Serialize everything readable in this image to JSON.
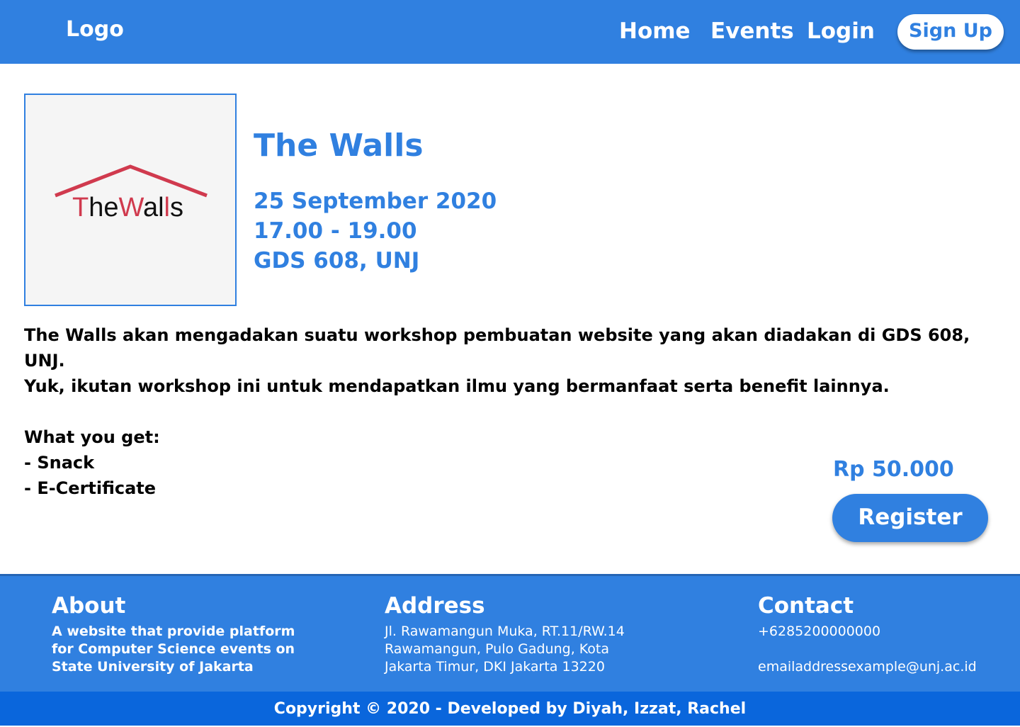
{
  "navbar": {
    "logo": "Logo",
    "links": [
      "Home",
      "Events",
      "Login"
    ],
    "signup_label": "Sign Up"
  },
  "event": {
    "logo_text": {
      "t": "T",
      "he": "he",
      "w": "W",
      "al": "al",
      "l": "l",
      "s": "s"
    },
    "title": "The Walls",
    "date": "25 September 2020",
    "time": "17.00 - 19.00",
    "location": "GDS 608, UNJ",
    "description_lines": [
      "The Walls akan mengadakan suatu workshop pembuatan website yang akan diadakan di GDS 608, UNJ.",
      "Yuk, ikutan workshop ini untuk mendapatkan ilmu yang bermanfaat serta benefit lainnya."
    ],
    "benefits_heading": "What you get:",
    "benefits": [
      "- Snack",
      "- E-Certificate"
    ],
    "price": "Rp 50.000",
    "register_label": "Register"
  },
  "footer": {
    "about": {
      "heading": "About",
      "lines": [
        "A website that provide platform",
        "for Computer Science events on",
        "State University of Jakarta"
      ]
    },
    "address": {
      "heading": "Address",
      "lines": [
        "Jl. Rawamangun Muka, RT.11/RW.14",
        "Rawamangun, Pulo Gadung, Kota",
        "Jakarta Timur, DKI Jakarta 13220"
      ]
    },
    "contact": {
      "heading": "Contact",
      "phone": "+6285200000000",
      "email": "emailaddressexample@unj.ac.id"
    },
    "copyright": "Copyright © 2020 - Developed by Diyah, Izzat, Rachel"
  },
  "colors": {
    "primary": "#3080E0",
    "copyright_bar": "#0A66DC",
    "logo_red": "#D03A4E",
    "logo_dark": "#111111"
  }
}
